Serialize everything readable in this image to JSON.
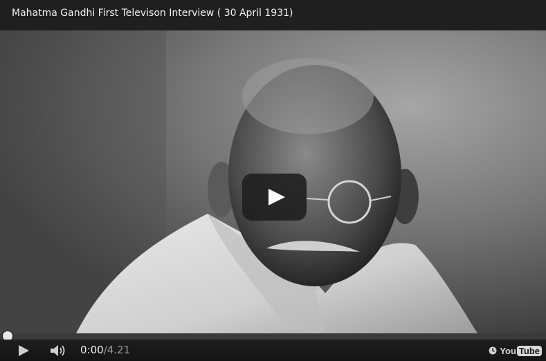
{
  "video": {
    "title": "Mahatma Gandhi First Televison Interview ( 30 April 1931)"
  },
  "controls": {
    "current_time": "0:00",
    "duration": "/4.21",
    "progress_fraction": 0
  },
  "branding": {
    "logo_you": "You",
    "logo_tube": "Tube"
  },
  "icons": {
    "big_play": "play-icon",
    "small_play": "play-icon",
    "volume": "volume-icon",
    "watch_later": "clock-icon"
  },
  "colors": {
    "progress_fill": "#cc0000",
    "title_bar": "#1f1f1f"
  }
}
